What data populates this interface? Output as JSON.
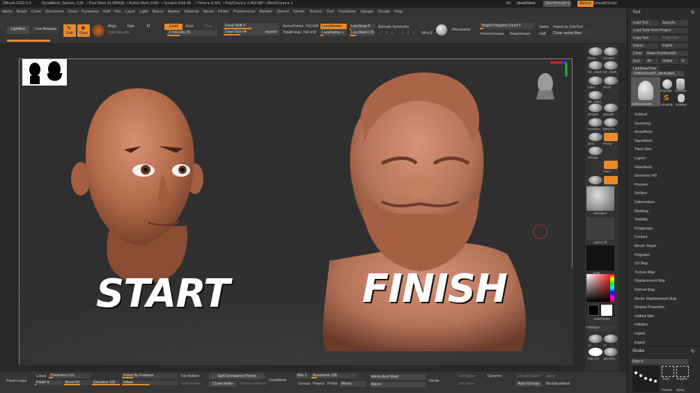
{
  "titlebar": {
    "app": "ZBrush 2022.0.5",
    "doc": "DynaMesh_Sphere_128",
    "freemem": "• Free Mem 51.889GB",
    "activemem": "• Active Mem 1040",
    "scratch": "• Scratch Disk 49",
    "timer": "• Timer ▸ 0.001",
    "polycount": "• PolyCount ▸ 1.483 MP",
    "meshcount": "• MeshCount ▸ 1",
    "ac": "AC",
    "quicksave": "QuickSave",
    "seethrough": "See-through",
    "seethrough_val": "0",
    "menus": "Menus",
    "script": "DefaultZScript"
  },
  "menu": [
    "Alpha",
    "Brush",
    "Color",
    "Document",
    "Draw",
    "Dynamics",
    "Edit",
    "File",
    "Layer",
    "Light",
    "Macro",
    "Marker",
    "Material",
    "Movie",
    "Picker",
    "Preferences",
    "Render",
    "Stencil",
    "Stroke",
    "Texture",
    "Tool",
    "Transform",
    "Zplugin",
    "Zscript",
    "Help"
  ],
  "topshelf": {
    "lightbox": "LightBox",
    "liveboolean": "Live Boolean",
    "edit": "Edit",
    "draw": "Draw",
    "mrgb": "Mrgb",
    "rgb": "Rgb",
    "m": "M",
    "rgbint": "Rgb Intensity",
    "zadd": "Zadd",
    "zsub": "Zsub",
    "zcut": "Zcut",
    "zint": "Z Intensity 25",
    "focal": "Focal Shift 0",
    "drawsize": "Draw Size 64",
    "dynamic": "Dynamic",
    "activepoints": "ActivePoints: 743,418",
    "totalpoints": "TotalPoints: 743,418",
    "lazymouse": "LazyMouse",
    "lazyradius": "LazyRadius 1",
    "lazysnap": "LazySnap 0",
    "lazystep": "LazyStep 0.25",
    "activesym": "Activate Symmetry",
    "spix": "SPix 3",
    "zremesher": "ZRemesher",
    "targetpoly": "Target Polygons Count 5",
    "freeze": "FreezeGroups",
    "keepgroups": "KeepGroups",
    "same": "Same",
    "half": "Half",
    "importsub": "Import as SubTool",
    "clearcache": "Clear cache files"
  },
  "canvas": {
    "start": "START",
    "finish": "FINISH"
  },
  "rightshelf": [
    "Move",
    "ClayBui",
    "SK_Slash",
    "SK_Cloth",
    "Inflat",
    "Pinch",
    "SK_Polis",
    "hPolish",
    "ZModel",
    "CurveTu",
    "IMM Pri",
    "Solo",
    "Persp",
    "Transp",
    "Floor",
    "L.Sym",
    "Local",
    "Standard",
    "Alpha Off",
    "Dots",
    "SwitchColor",
    "FillObject",
    "x4",
    "z7",
    "Flat Col",
    "SkinSha"
  ],
  "tool": {
    "title": "Tool",
    "loadtool": "Load Tool",
    "saveas": "Save As",
    "loadproj": "Load Tools From Project",
    "copy": "Copy Tool",
    "paste": "Paste Tool",
    "import": "Import",
    "export": "Export",
    "clone": "Clone",
    "makepoly": "Make PolyMesh3D",
    "goz": "GoZ",
    "all": "All",
    "visible": "Visible",
    "r": "R",
    "lightbox": "Lightbox▸Tools",
    "current": "OldManBust05_decimated_",
    "thumbs": [
      "OldManBust05",
      "PolySph",
      "Cylinder",
      "SimpleB",
      "OldMan"
    ],
    "items": [
      "Subtool",
      "Geometry",
      "ArrayMesh",
      "NanoMesh",
      "Thick Skin",
      "Layers",
      "FiberMesh",
      "Geometry HD",
      "Preview",
      "Surface",
      "Deformation",
      "Masking",
      "Visibility",
      "Polygroups",
      "Contact",
      "Morph Target",
      "Polypaint",
      "UV Map",
      "Texture Map",
      "Displacement Map",
      "Normal Map",
      "Vector Displacement Map",
      "Display Properties",
      "Unified Skin",
      "Initialize",
      "Import",
      "Export"
    ],
    "stroke": "Stroke",
    "dots": "Dots 0",
    "dotsl": "Dots",
    "dragrect": "DragRe",
    "freehand": "FreeHa",
    "spray": "Spray",
    "dragdot": "DragDo"
  },
  "bottom": {
    "panelloops": "Panel Loops",
    "loops": "Loops",
    "thickness": "Thickness 0.01",
    "polish": "Polish 5",
    "bevel": "Bevel 60",
    "polishfeat": "Polish By Features",
    "elevation": "Elevation 100",
    "inflate": "Inflate",
    "delhidden": "Del Hidden",
    "splithidden": "Split Hidden",
    "splitunmasked": "Split Unmasked Points",
    "closeholes": "Close Holes",
    "meshfrombrush": "MeshFromBrush",
    "dynamesh": "DynaMesh",
    "blur": "Blur 2",
    "resolution": "Resolution 128",
    "groups": "Groups",
    "project": "Project",
    "polishb": "Polish",
    "mirror": "Mirror",
    "mirrorweld": "Mirror And Weld",
    "mirror2": "Mirror",
    "divide": "Divide",
    "delhigher": "Del Higher",
    "dellower": "Del Lower",
    "dynamic": "Dynamic",
    "smooth": "SmoothSubdiv",
    "apply": "Apply",
    "autogroups": "Auto Groups",
    "backface": "BackfaceMask"
  },
  "colors": {
    "accent": "#e98a2b",
    "skin": "#b86f4e",
    "clay": "#b87458"
  }
}
